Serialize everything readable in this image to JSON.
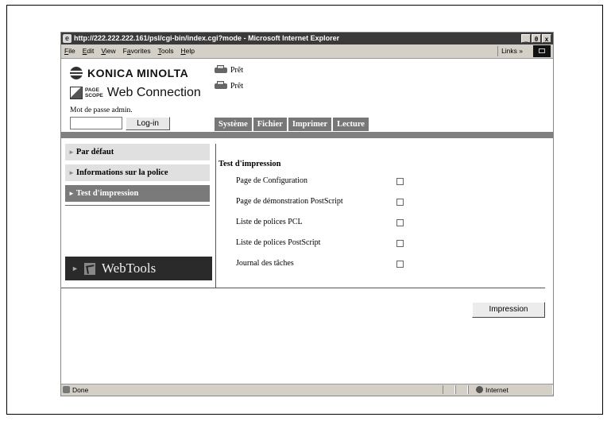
{
  "browser": {
    "title": "http://222.222.222.161/psl/cgi-bin/index.cgi?mode - Microsoft Internet Explorer",
    "win_buttons": [
      "_",
      "θ",
      "x"
    ],
    "menu": [
      {
        "pre": "",
        "u": "F",
        "post": "ile"
      },
      {
        "pre": "",
        "u": "E",
        "post": "dit"
      },
      {
        "pre": "",
        "u": "V",
        "post": "iew"
      },
      {
        "pre": "F",
        "u": "a",
        "post": "vorites"
      },
      {
        "pre": "",
        "u": "T",
        "post": "ools"
      },
      {
        "pre": "",
        "u": "H",
        "post": "elp"
      }
    ],
    "links": "Links »",
    "status_text": "Done",
    "zone": "Internet"
  },
  "header": {
    "brand": "KONICA MINOLTA",
    "pagescope": "PAGE\nSCOPE",
    "web_connection": "Web Connection",
    "password_label": "Mot de passe admin.",
    "login_button": "Log-in",
    "status": [
      "Prêt",
      "Prêt"
    ]
  },
  "tabs": [
    "Système",
    "Fichier",
    "Imprimer",
    "Lecture"
  ],
  "sidebar": {
    "items": [
      {
        "label": "Par défaut",
        "active": false
      },
      {
        "label": "Informations sur la police",
        "active": false
      },
      {
        "label": "Test d'impression",
        "active": true
      }
    ],
    "webtools": "WebTools"
  },
  "main": {
    "title": "Test d'impression",
    "options": [
      {
        "label": "Page de Configuration",
        "checked": false
      },
      {
        "label": "Page de démonstration PostScript",
        "checked": false
      },
      {
        "label": "Liste de polices PCL",
        "checked": false
      },
      {
        "label": "Liste de polices PostScript",
        "checked": false
      },
      {
        "label": "Journal des tâches",
        "checked": false
      }
    ],
    "print_button": "Impression"
  }
}
